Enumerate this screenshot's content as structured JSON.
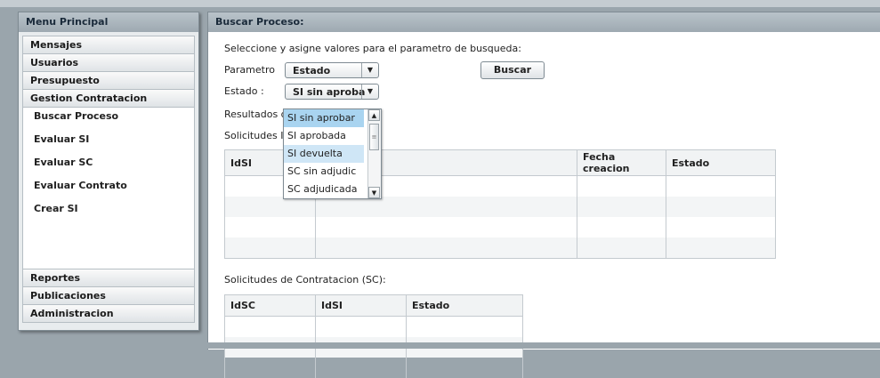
{
  "sidebar": {
    "title": "Menu Principal",
    "items_top": [
      "Mensajes",
      "Usuarios",
      "Presupuesto",
      "Gestion Contratacion"
    ],
    "sub_items": [
      "Buscar Proceso",
      "Evaluar SI",
      "Evaluar SC",
      "Evaluar Contrato",
      "Crear SI"
    ],
    "items_bottom": [
      "Reportes",
      "Publicaciones",
      "Administracion"
    ]
  },
  "main": {
    "title": "Buscar Proceso:",
    "instruction": "Seleccione y asigne valores para el parametro de busqueda:",
    "parametro_label": "Parametro",
    "parametro_value": "Estado",
    "estado_label": "Estado :",
    "estado_value": "SI sin aproba",
    "buscar_label": "Buscar",
    "resultados_label": "Resultados d",
    "solicitudes_si_label": "Solicitudes I",
    "si_table": {
      "headers": [
        "IdSI",
        "",
        "Fecha creacion",
        "Estado"
      ]
    },
    "sc_label": "Solicitudes de Contratacion (SC):",
    "sc_table": {
      "headers": [
        "IdSC",
        "IdSI",
        "Estado"
      ]
    }
  },
  "dropdown": {
    "options": [
      "SI sin aprobar",
      "SI aprobada",
      "SI devuelta",
      "SC sin adjudic",
      "SC adjudicada"
    ],
    "selected_index": 0,
    "hover_index": 2
  },
  "colors": {
    "background": "#9aa5ac",
    "header": "#b9c3ca",
    "selected": "#a9d4f0"
  },
  "icons": {
    "dropdown_arrow": "arrow-down-icon",
    "scroll_up": "arrow-up-icon",
    "scroll_down": "arrow-down-icon"
  }
}
